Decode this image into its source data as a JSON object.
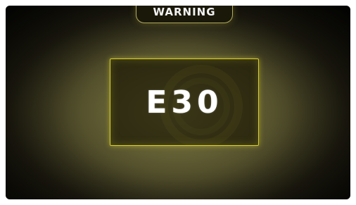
{
  "header": {
    "title": "WARNING"
  },
  "error": {
    "code": "E30"
  },
  "colors": {
    "accent": "#d8ce2f",
    "background": "#38340a",
    "text": "#ffffff"
  }
}
